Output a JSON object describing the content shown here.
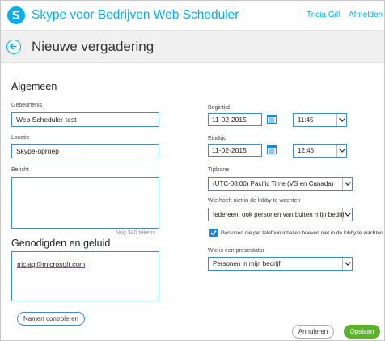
{
  "header": {
    "app_title": "Skype voor Bedrijven Web Scheduler",
    "user_name": "Tricia Gill",
    "signout_label": "Afmelden",
    "logo_letter": "S"
  },
  "page": {
    "title": "Nieuwe vergadering"
  },
  "general": {
    "heading": "Algemeen",
    "event_label": "Gebeurtenis",
    "event_value": "Web Scheduler-test",
    "location_label": "Locatie",
    "location_value": "Skype-oproep",
    "message_label": "Bericht",
    "message_value": "",
    "char_counter": "Nog 340 tekens"
  },
  "guests": {
    "heading": "Genodigden en geluid",
    "attendee_value": "triciag@microsoft.com",
    "check_names_label": "Namen controleren"
  },
  "schedule": {
    "start_label": "Begintijd",
    "start_date": "11-02-2015",
    "start_time": "11:45",
    "end_label": "Eindtijd",
    "end_date": "11-02-2015",
    "end_time": "12:45",
    "timezone_label": "Tijdzone",
    "timezone_value": "(UTC-08:00) Pacific Time (VS en Canada)",
    "lobby_label": "Wie hoeft niet in de lobby te wachten",
    "lobby_value": "Iedereen, ook personen van buiten mijn bedrijf",
    "phone_bypass_label": "Personen die per telefoon inbellen hoeven niet in de lobby te wachten",
    "phone_bypass_checked": true,
    "presenter_label": "Wie is een presentator",
    "presenter_value": "Personen in mijn bedrijf"
  },
  "footer": {
    "cancel_label": "Annuleren",
    "save_label": "Opslaan"
  },
  "colors": {
    "accent": "#00aff0",
    "field_border": "#3a8ecc",
    "save_green": "#5cb130"
  }
}
